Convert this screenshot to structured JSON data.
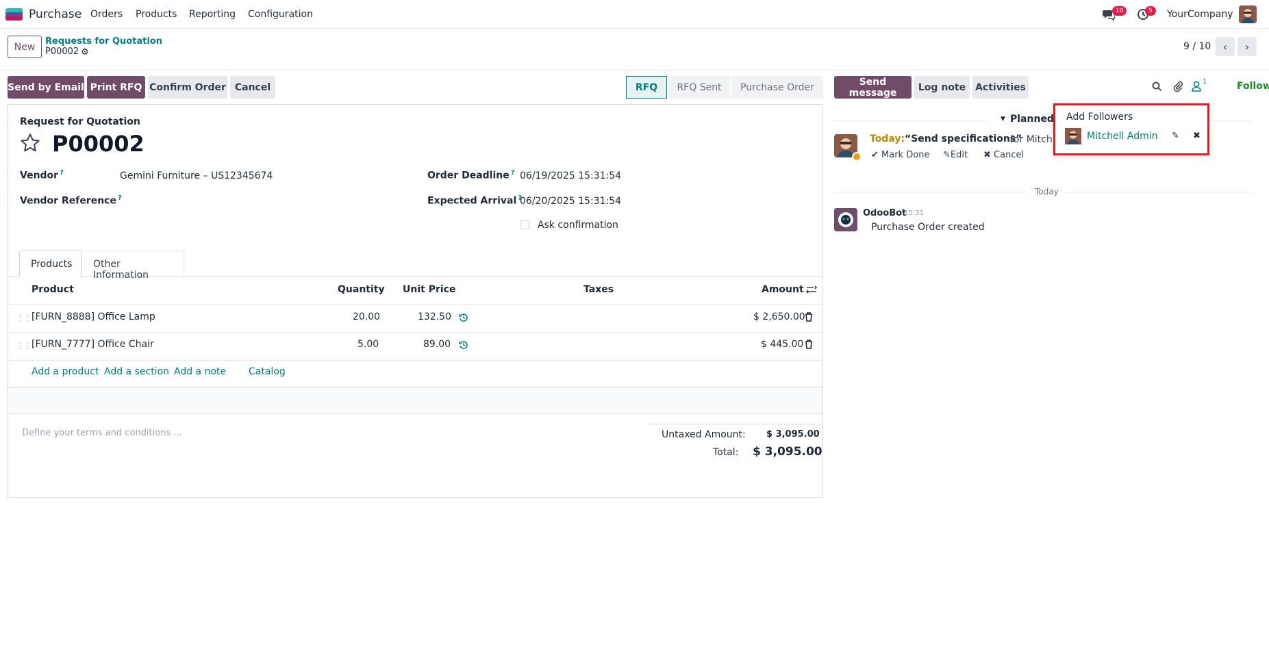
{
  "nav": {
    "app_name": "Purchase",
    "menu": [
      "Orders",
      "Products",
      "Reporting",
      "Configuration"
    ],
    "messages_badge": "10",
    "activities_badge": "5",
    "company": "YourCompany"
  },
  "control": {
    "new_label": "New",
    "breadcrumb_parent": "Requests for Quotation",
    "breadcrumb_current": "P00002",
    "pager": "9 / 10"
  },
  "actions": {
    "send_email": "Send by Email",
    "print_rfq": "Print RFQ",
    "confirm_order": "Confirm Order",
    "cancel": "Cancel"
  },
  "statusbar": [
    "RFQ",
    "RFQ Sent",
    "Purchase Order"
  ],
  "form": {
    "doc_type": "Request for Quotation",
    "name": "P00002",
    "vendor_label": "Vendor",
    "vendor_value": "Gemini Furniture – US12345674",
    "vendor_ref_label": "Vendor Reference",
    "deadline_label": "Order Deadline",
    "deadline_value": "06/19/2025 15:31:54",
    "arrival_label": "Expected Arrival",
    "arrival_value": "06/20/2025 15:31:54",
    "ask_confirmation": "Ask confirmation",
    "help_mark": "?"
  },
  "tabs": [
    "Products",
    "Other Information"
  ],
  "table": {
    "headers": [
      "Product",
      "Quantity",
      "Unit Price",
      "Taxes",
      "Amount"
    ],
    "rows": [
      {
        "product": "[FURN_8888] Office Lamp",
        "quantity": "20.00",
        "unit_price": "132.50",
        "amount": "$ 2,650.00"
      },
      {
        "product": "[FURN_7777] Office Chair",
        "quantity": "5.00",
        "unit_price": "89.00",
        "amount": "$ 445.00"
      }
    ],
    "add_product": "Add a product",
    "add_section": "Add a section",
    "add_note": "Add a note",
    "catalog": "Catalog"
  },
  "totals": {
    "terms_placeholder": "Define your terms and conditions ...",
    "untaxed_label": "Untaxed Amount:",
    "untaxed_value": "$ 3,095.00",
    "total_label": "Total:",
    "total_value": "$ 3,095.00"
  },
  "chatter": {
    "send_message": "Send message",
    "log_note": "Log note",
    "activities": "Activities",
    "followers_count": "1",
    "following": "Following",
    "planned": "Planned",
    "activity_today": "Today:",
    "activity_title": "“Send specifications”",
    "activity_for": "for Mitch",
    "mark_done": "Mark Done",
    "edit": "Edit",
    "cancel": "Cancel",
    "day_separator": "Today",
    "msg_author": "OdooBot",
    "msg_time": "15:31",
    "msg_body": "Purchase Order created"
  },
  "followers_popover": {
    "add_followers": "Add Followers",
    "follower_name": "Mitchell Admin"
  },
  "colors": {
    "brand": "#714b67",
    "link": "#017e84",
    "following": "#1a8b2a",
    "highlight_border": "#e01b24"
  }
}
